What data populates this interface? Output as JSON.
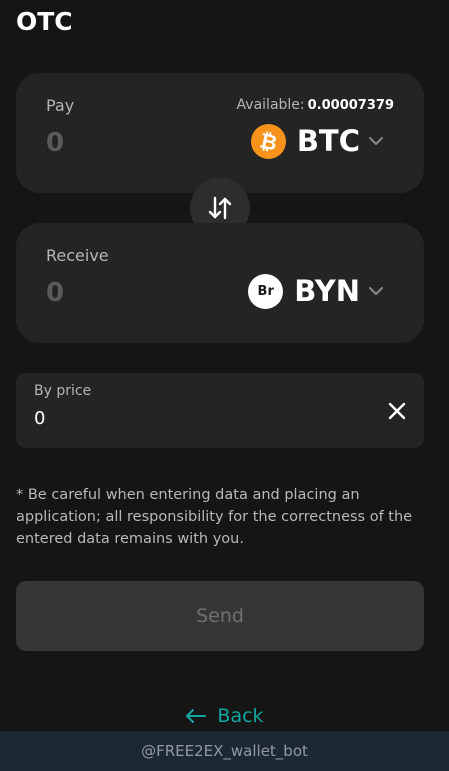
{
  "header": {
    "title": "OTC"
  },
  "pay": {
    "label": "Pay",
    "amount": "0",
    "available_label": "Available:",
    "available_value": "0.00007379",
    "currency": {
      "code": "BTC",
      "icon": "bitcoin-icon",
      "icon_symbol": "₿",
      "color": "#f7931a"
    }
  },
  "swap": {
    "icon": "swap-arrows-icon"
  },
  "receive": {
    "label": "Receive",
    "amount": "0",
    "currency": {
      "code": "BYN",
      "icon": "byn-icon",
      "icon_symbol": "Br",
      "color": "#ffffff"
    }
  },
  "price": {
    "label": "By price",
    "value": "0",
    "clear_icon": "close-icon"
  },
  "disclaimer": "* Be careful when entering data and placing an application; all responsibility for the correctness of the entered data remains with you.",
  "send_label": "Send",
  "back_label": "Back",
  "footer_text": "@FREE2EX_wallet_bot",
  "colors": {
    "background": "#151515",
    "card": "#242424",
    "accent": "#12a6a1",
    "btc": "#f7931a"
  }
}
